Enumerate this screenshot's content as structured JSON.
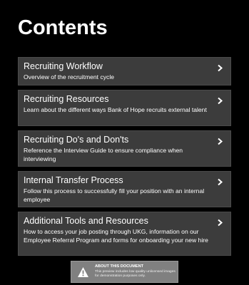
{
  "page": {
    "title": "Contents"
  },
  "cards": [
    {
      "title": "Recruiting Workflow",
      "description": "Overview of the recruitment cycle"
    },
    {
      "title": "Recruiting Resources",
      "description": "Learn about the different ways Bank of Hope recruits external talent"
    },
    {
      "title": "Recruiting Do's and Don'ts",
      "description": "Reference the Interview Guide to ensure compliance when interviewing"
    },
    {
      "title": "Internal Transfer Process",
      "description": "Follow this process to successfully fill your position with an internal employee"
    },
    {
      "title": "Additional Tools and Resources",
      "description": "How to access your job posting through UKG, information on our Employee Referral Program and forms for onboarding your new hire"
    }
  ],
  "notice": {
    "title": "ABOUT THIS DOCUMENT",
    "text": "This preview includes low quality unlicensed images for demonstration purposes only.",
    "icon": "warning-icon"
  },
  "colors": {
    "background": "#000000",
    "card": "#3c3c3c",
    "notice": "#808080",
    "text": "#ffffff"
  }
}
